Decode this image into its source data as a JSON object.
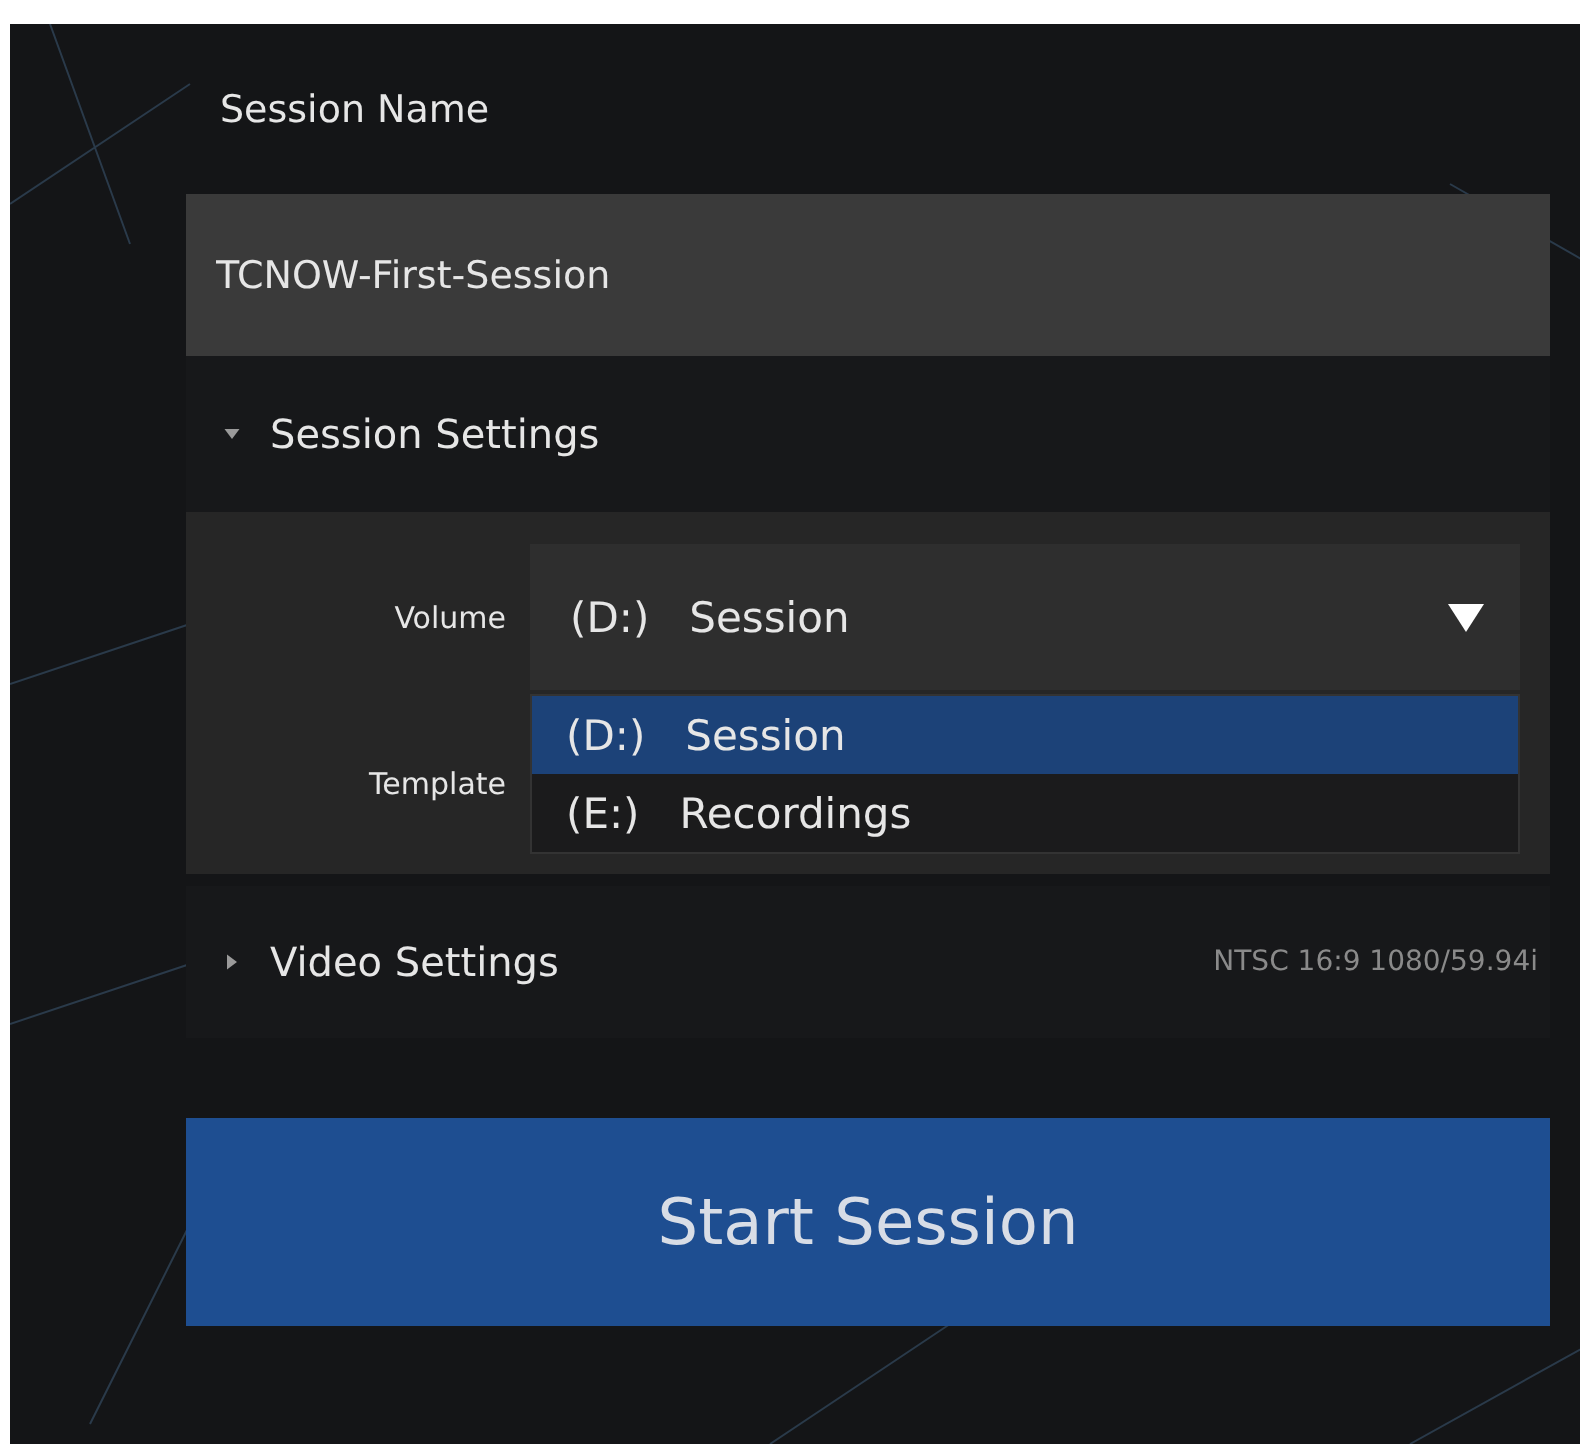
{
  "session_name": {
    "label": "Session Name",
    "value": "TCNOW-First-Session"
  },
  "session_settings": {
    "label": "Session Settings",
    "expanded": true,
    "volume": {
      "label": "Volume",
      "drive": "(D:)",
      "name": "Session",
      "open": true,
      "options": [
        {
          "drive": "(D:)",
          "name": "Session",
          "selected": true
        },
        {
          "drive": "(E:)",
          "name": "Recordings",
          "selected": false
        }
      ]
    },
    "template": {
      "label": "Template"
    }
  },
  "video_settings": {
    "label": "Video Settings",
    "expanded": false,
    "summary": "NTSC 16:9 1080/59.94i"
  },
  "start_button": {
    "label": "Start Session"
  }
}
